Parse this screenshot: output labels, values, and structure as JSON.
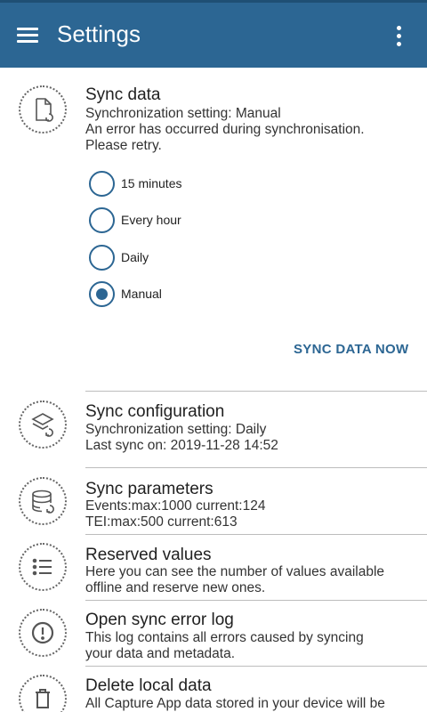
{
  "appbar": {
    "title": "Settings",
    "menu_icon": "menu-icon",
    "more_icon": "more-vert-icon"
  },
  "colors": {
    "primary": "#2c6693",
    "text": "#212121",
    "divider": "#bdbdbd"
  },
  "sync_data": {
    "icon": "file-sync-icon",
    "title": "Sync data",
    "setting": "Synchronization setting: Manual",
    "error_line1": "An error has occurred during synchronisation.",
    "error_line2": "Please retry.",
    "options": [
      {
        "label": "15 minutes",
        "selected": false
      },
      {
        "label": "Every hour",
        "selected": false
      },
      {
        "label": "Daily",
        "selected": false
      },
      {
        "label": "Manual",
        "selected": true
      }
    ],
    "action_label": "SYNC DATA NOW"
  },
  "sync_configuration": {
    "icon": "layers-sync-icon",
    "title": "Sync configuration",
    "line1": "Synchronization setting: Daily",
    "line2": "Last sync on: 2019-11-28 14:52"
  },
  "sync_parameters": {
    "icon": "database-sync-icon",
    "title": "Sync parameters",
    "line1": "Events:max:1000 current:124",
    "line2": "TEI:max:500 current:613"
  },
  "reserved_values": {
    "icon": "list-icon",
    "title": "Reserved values",
    "line1": "Here you can see the number of values available",
    "line2": "offline and reserve new ones."
  },
  "error_log": {
    "icon": "alert-circle-icon",
    "title": "Open sync error log",
    "line1": "This log contains all errors caused by syncing",
    "line2": "your data and metadata."
  },
  "delete_data": {
    "icon": "trash-icon",
    "title": "Delete local data",
    "line1": "All Capture App data stored in your device will be"
  }
}
